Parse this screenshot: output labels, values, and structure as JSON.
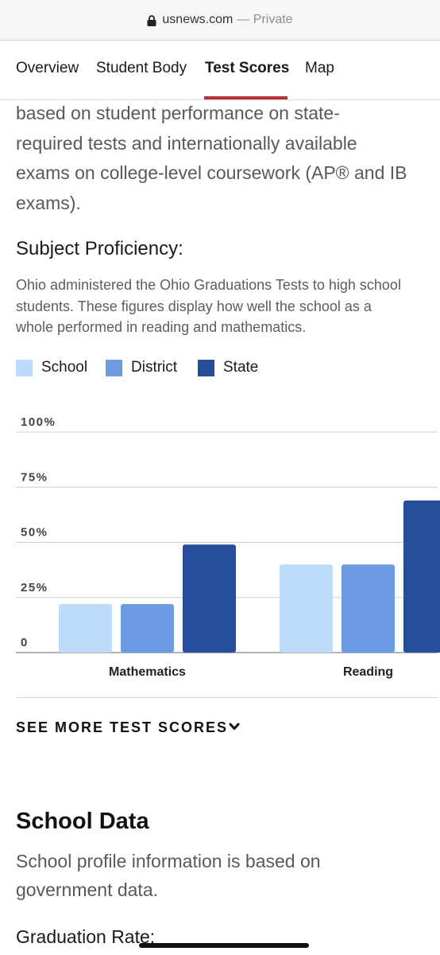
{
  "browser": {
    "domain": "usnews.com",
    "separator": "—",
    "mode": "Private"
  },
  "tabs": [
    {
      "label": "Overview",
      "active": false
    },
    {
      "label": "Student Body",
      "active": false
    },
    {
      "label": "Test Scores",
      "active": true
    },
    {
      "label": "Map",
      "active": false
    }
  ],
  "intro_lines": [
    "based on student performance on state-",
    "required tests and internationally available",
    "exams on college-level coursework (AP® and IB",
    "exams)."
  ],
  "subject_proficiency": {
    "heading": "Subject Proficiency:",
    "description_lines": [
      "Ohio administered the Ohio Graduations Tests to high school",
      "students. These figures display how well the school as a",
      "whole performed in reading and mathematics."
    ]
  },
  "legend": [
    {
      "label": "School",
      "color": "#bddcfb"
    },
    {
      "label": "District",
      "color": "#6b9be3"
    },
    {
      "label": "State",
      "color": "#264d99"
    }
  ],
  "chart_data": {
    "type": "bar",
    "categories": [
      "Mathematics",
      "Reading"
    ],
    "series": [
      {
        "name": "School",
        "values": [
          22,
          40
        ]
      },
      {
        "name": "District",
        "values": [
          22,
          40
        ]
      },
      {
        "name": "State",
        "values": [
          49,
          69
        ]
      }
    ],
    "y_tick_labels": [
      "0",
      "25%",
      "50%",
      "75%",
      "100%"
    ],
    "ylim": [
      0,
      100
    ],
    "grid": true,
    "legend_position": "top-left"
  },
  "see_more": {
    "label": "SEE MORE TEST SCORES",
    "icon": "chevron-down-icon"
  },
  "school_data": {
    "heading": "School Data",
    "description_lines": [
      "School profile information is based on",
      "government data."
    ]
  },
  "graduation_rate": {
    "label": "Graduation Rate:"
  }
}
